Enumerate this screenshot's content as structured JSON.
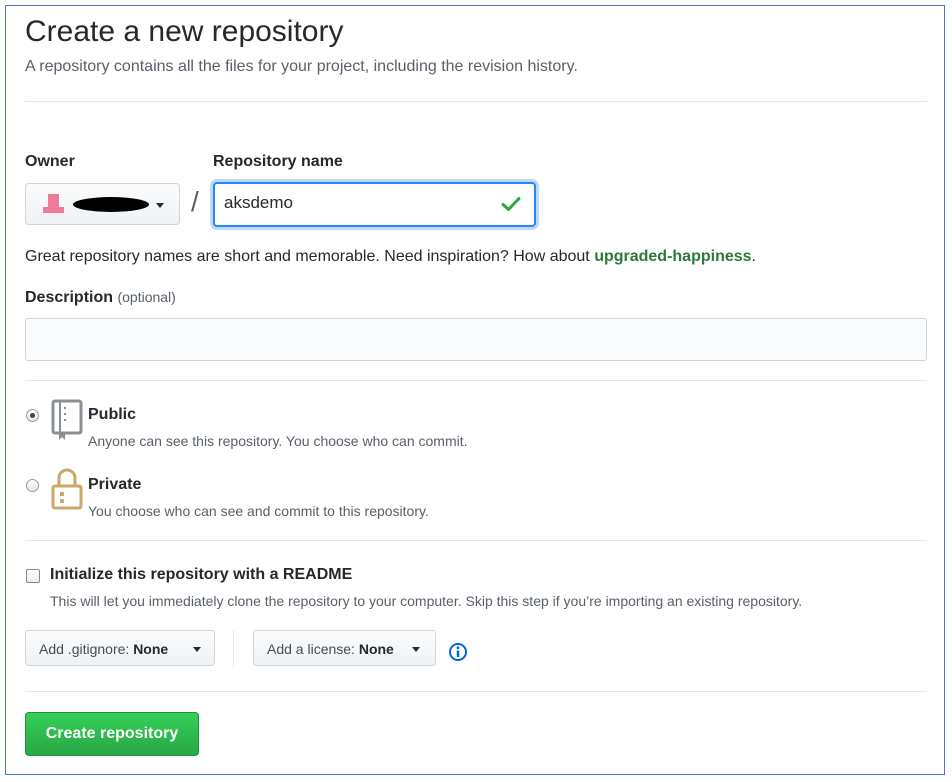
{
  "header": {
    "title": "Create a new repository",
    "subtitle": "A repository contains all the files for your project, including the revision history."
  },
  "owner": {
    "label": "Owner"
  },
  "repo": {
    "label": "Repository name",
    "separator": "/",
    "value": "aksdemo",
    "hint_prefix": "Great repository names are short and memorable. Need inspiration? How about ",
    "suggestion": "upgraded-happiness",
    "hint_suffix": "."
  },
  "description": {
    "label": "Description",
    "optional": "(optional)",
    "value": ""
  },
  "visibility": {
    "public": {
      "title": "Public",
      "desc": "Anyone can see this repository. You choose who can commit.",
      "selected": true
    },
    "private": {
      "title": "Private",
      "desc": "You choose who can see and commit to this repository.",
      "selected": false
    }
  },
  "readme": {
    "label": "Initialize this repository with a README",
    "desc": "This will let you immediately clone the repository to your computer. Skip this step if you’re importing an existing repository.",
    "checked": false
  },
  "gitignore": {
    "prefix": "Add .gitignore:",
    "value": "None"
  },
  "license": {
    "prefix": "Add a license:",
    "value": "None"
  },
  "submit": {
    "label": "Create repository"
  },
  "colors": {
    "accent_green": "#28a745",
    "focus_blue": "#2188ff",
    "info_blue": "#0366d6",
    "frame_border": "#4a7ac4"
  },
  "icons": {
    "owner_avatar": "avatar-icon",
    "valid": "check-icon",
    "public": "repo-book-icon",
    "private": "lock-icon",
    "info": "info-icon"
  }
}
